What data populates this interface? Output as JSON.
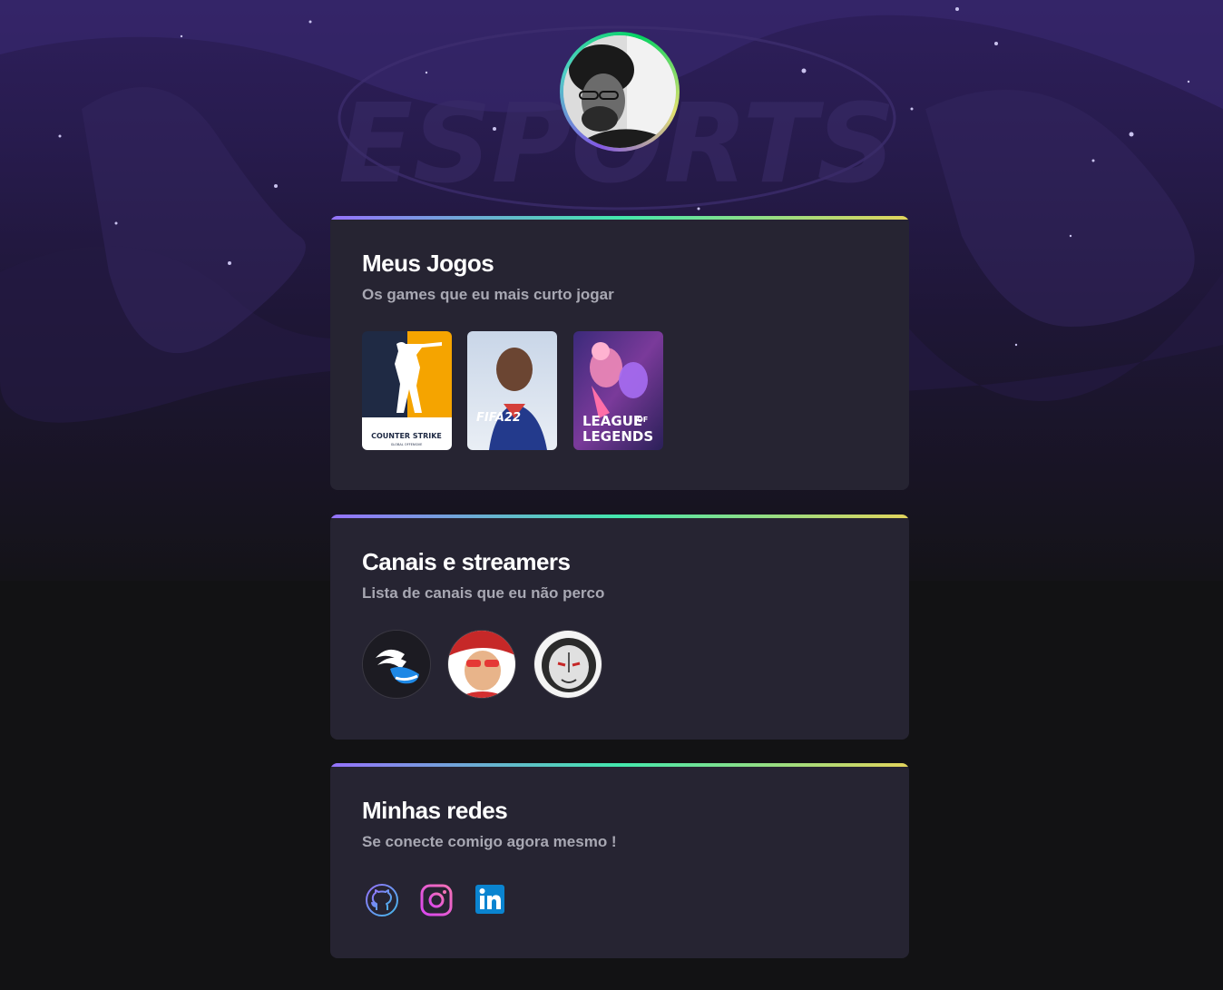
{
  "background": {
    "watermark": "ESPORTS"
  },
  "profile": {
    "avatar": "user-photo"
  },
  "sections": {
    "games": {
      "title": "Meus Jogos",
      "subtitle": "Os games que eu mais curto jogar",
      "items": [
        {
          "name": "COUNTER STRIKE",
          "tag": "GLOBAL OFFENSIVE"
        },
        {
          "name": "FIFA22"
        },
        {
          "name": "LEAGUE OF LEGENDS",
          "line1": "LEAGUE",
          "of": "OF",
          "line2": "LEGENDS"
        }
      ]
    },
    "streamers": {
      "title": "Canais e streamers",
      "subtitle": "Lista de canais que eu não perco"
    },
    "social": {
      "title": "Minhas redes",
      "subtitle": "Se conecte comigo agora mesmo !",
      "links": [
        "github-icon",
        "instagram-icon",
        "linkedin-icon"
      ]
    }
  },
  "colors": {
    "gradient": [
      "#9572fc",
      "#43e7ad",
      "#e2d45c"
    ],
    "card": "#262432",
    "text_muted": "#a8a8b3"
  }
}
